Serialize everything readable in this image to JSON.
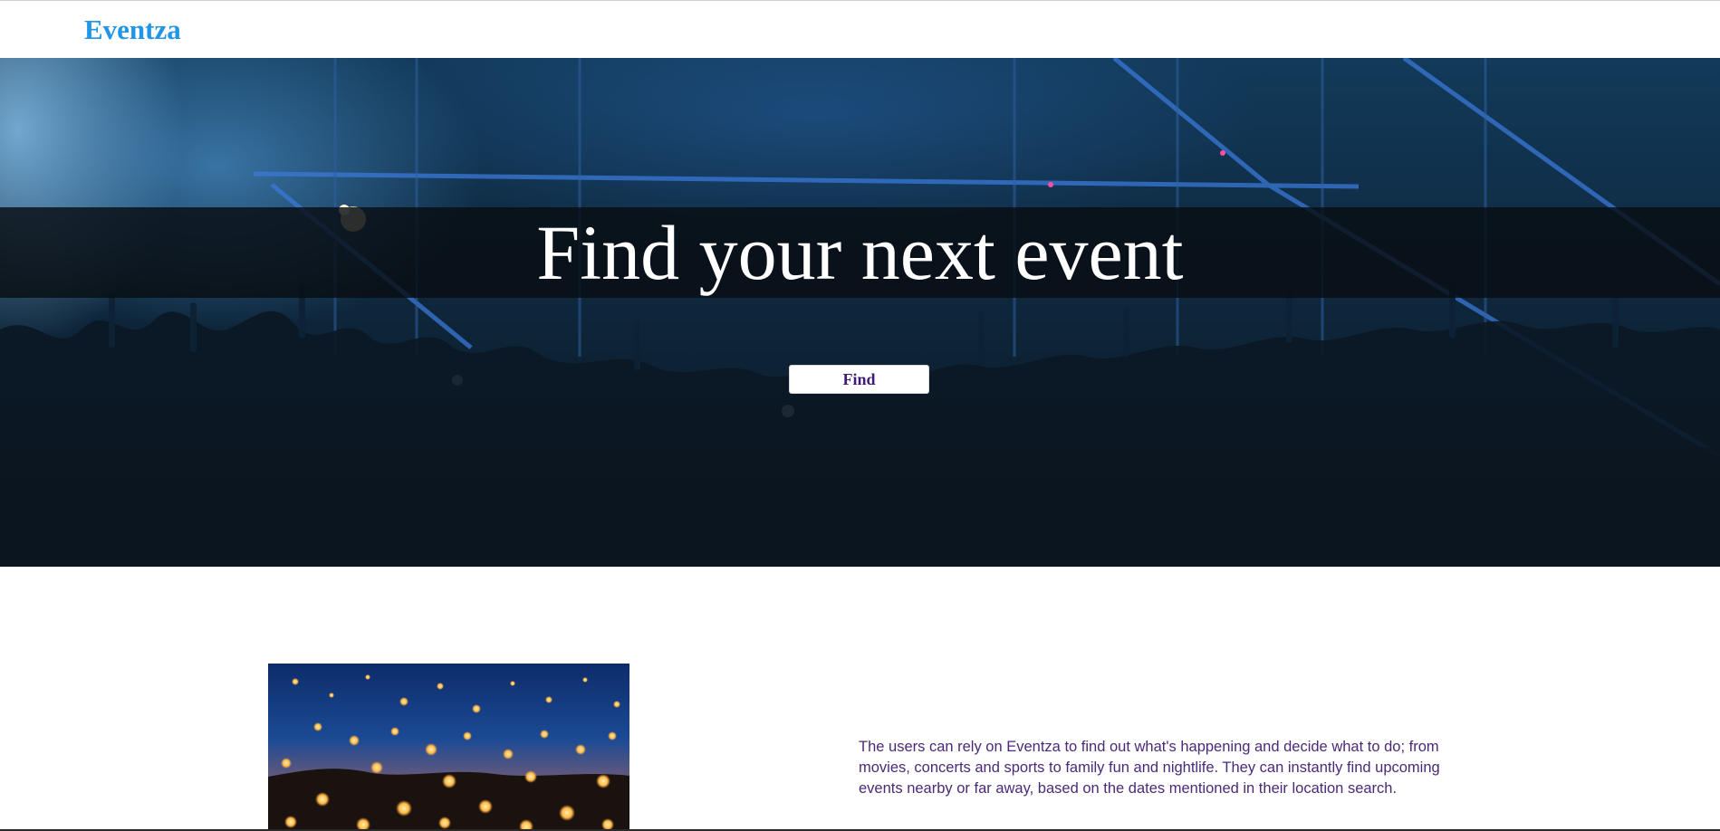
{
  "navbar": {
    "brand": "Eventza"
  },
  "hero": {
    "headline": "Find your next event",
    "find_button_label": "Find"
  },
  "about": {
    "text": "The users can rely on Eventza to find out what's happening and decide what to do; from movies, concerts and sports to family fun and nightlife. They can instantly find upcoming events nearby or far away, based on the dates mentioned in their location search."
  },
  "colors": {
    "brand": "#2196e6",
    "button_text": "#3d1a78",
    "body_text": "#4a2a78"
  }
}
